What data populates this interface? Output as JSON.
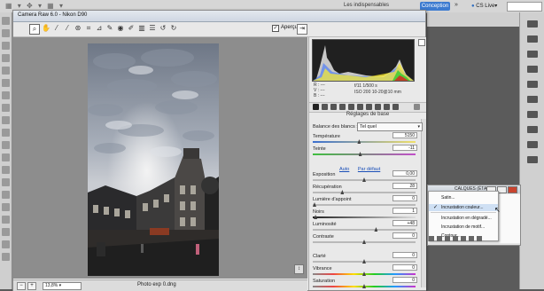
{
  "photoshop": {
    "workspace_label": "Les indispensables",
    "active_button": "Conception",
    "overflow_icon": "double-chevron",
    "cslive_label": "CS Live▾"
  },
  "camera_raw": {
    "title": "Camera Raw 6.0 - Nikon D90",
    "preview_label": "Aperçu",
    "preview_checked": true,
    "tools": [
      "zoom-icon",
      "hand-icon",
      "white-balance-icon",
      "color-sampler-icon",
      "target-adjust-icon",
      "crop-icon",
      "straighten-icon",
      "spot-removal-icon",
      "red-eye-icon",
      "adjustment-brush-icon",
      "graduated-filter-icon",
      "preferences-icon",
      "rotate-left-icon",
      "rotate-right-icon"
    ],
    "zoom_value": "13,8%",
    "filename": "Photo exp 0.dng",
    "exif": {
      "r": "R :  ---",
      "g": "V :  ---",
      "b": "B :  ---",
      "aperture_shutter": "f/11   1/500 s",
      "iso_lens": "ISO 200   10-20@10 mm"
    },
    "panel_title": "Réglages de base",
    "white_balance": {
      "label": "Balance des blancs :",
      "value": "Tel quel"
    },
    "links": {
      "auto": "Auto",
      "default": "Par défaut"
    },
    "sliders": [
      {
        "label": "Température",
        "value": "5150",
        "fraction": 0.45,
        "track": "temp"
      },
      {
        "label": "Teinte",
        "value": "-11",
        "fraction": 0.46,
        "track": "tint"
      },
      {
        "label": "Exposition",
        "value": "0,00",
        "fraction": 0.5,
        "track": "plain"
      },
      {
        "label": "Récupération",
        "value": "28",
        "fraction": 0.28,
        "track": "plain"
      },
      {
        "label": "Lumière d'appoint",
        "value": "0",
        "fraction": 0.0,
        "track": "plain"
      },
      {
        "label": "Noirs",
        "value": "1",
        "fraction": 0.01,
        "track": "dark"
      },
      {
        "label": "Luminosité",
        "value": "+48",
        "fraction": 0.62,
        "track": "plain"
      },
      {
        "label": "Contraste",
        "value": "0",
        "fraction": 0.5,
        "track": "plain"
      },
      {
        "label": "Clarté",
        "value": "0",
        "fraction": 0.5,
        "track": "plain"
      },
      {
        "label": "Vibrance",
        "value": "0",
        "fraction": 0.5,
        "track": "sat"
      },
      {
        "label": "Saturation",
        "value": "0",
        "fraction": 0.5,
        "track": "sat"
      }
    ]
  },
  "layers_panel": {
    "title": "CALQUES  (ÉTAT)",
    "menu": [
      {
        "label": "Satin...",
        "checked": false,
        "highlight": false
      },
      {
        "label": "Incrustation couleur...",
        "checked": true,
        "highlight": true
      },
      {
        "label": "Incrustation en dégradé...",
        "checked": false,
        "highlight": false
      },
      {
        "label": "Incrustation de motif...",
        "checked": false,
        "highlight": false
      },
      {
        "label": "Contour...",
        "checked": false,
        "highlight": false
      }
    ]
  }
}
